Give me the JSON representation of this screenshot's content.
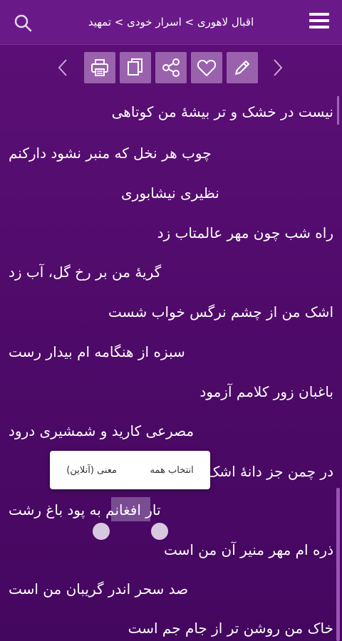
{
  "header": {
    "breadcrumb": "اقبال لاهوری > اسرار خودی > تمهید"
  },
  "toolbar": {
    "buttons": [
      "edit",
      "favorite",
      "share",
      "copy",
      "print"
    ]
  },
  "poem": {
    "lines": [
      "نیست در خشک و تر بیشهٔ من کوتاهی",
      "چوب هر نخل که منبر نشود دارکنم",
      "نظیری نیشابوری",
      "راه شب چون مهر عالمتاب زد",
      "گریهٔ من بر رخ گل، آب زد",
      "اشک من از چشم نرگس خواب شست",
      "سبزه از هنگامه ام بیدار رست",
      "باغبان زور کلامم آزمود",
      "مصرعی کارید و شمشیری درود",
      "در چمن جز دانهٔ اشکم نکشت",
      "تار افغانم به پود باغ رشت",
      "ذره ام مهر منیر آن من است",
      "صد سحر اندر گریبان من است",
      "خاک من روشن تر از جام جم است"
    ],
    "line_10_visible": "در چمن جز دانهٔ اشک",
    "selected_word": "افغانم"
  },
  "selection_menu": {
    "select_all": "انتخاب همه",
    "meaning_online": "معنی (آنلاین)"
  }
}
